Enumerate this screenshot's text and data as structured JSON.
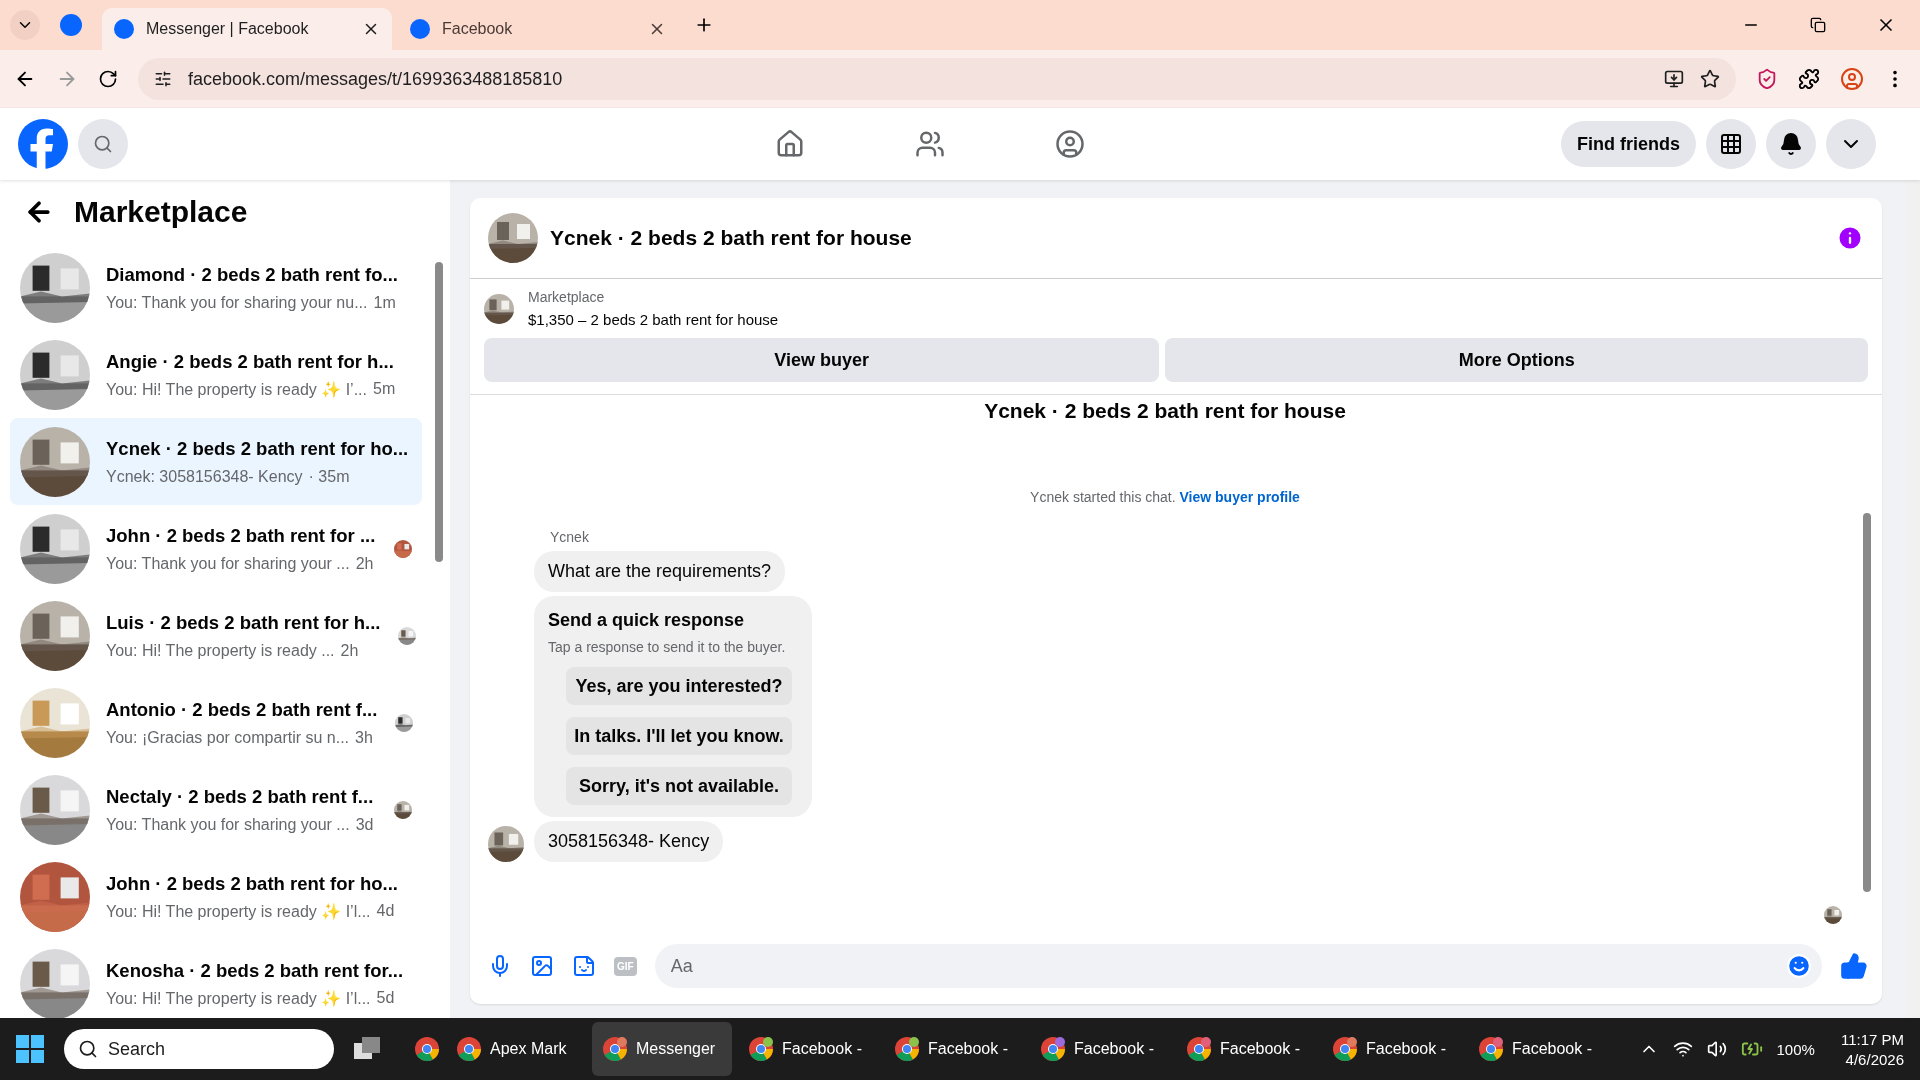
{
  "browser": {
    "tabs": [
      {
        "title": "Messenger | Facebook",
        "selected": true
      },
      {
        "title": "Facebook",
        "selected": false
      }
    ],
    "url": "facebook.com/messages/t/1699363488185810"
  },
  "header": {
    "find_friends": "Find friends"
  },
  "sidebar": {
    "title": "Marketplace",
    "conversations": [
      {
        "title": "Diamond · 2 beds 2 bath rent fo...",
        "preview": "You: Thank you for sharing your nu...",
        "time": "1m",
        "selected": false,
        "seen": false
      },
      {
        "title": "Angie · 2 beds 2 bath rent for h...",
        "preview": "You: Hi! The property is ready ✨ I’...",
        "time": "5m",
        "selected": false,
        "seen": false
      },
      {
        "title": "Ycnek · 2 beds 2 bath rent for ho...",
        "preview": "Ycnek: 3058156348- Kency",
        "time": "· 35m",
        "selected": true,
        "seen": false
      },
      {
        "title": "John · 2 beds 2 bath rent for ...",
        "preview": "You: Thank you for sharing your ...",
        "time": "2h",
        "selected": false,
        "seen": true
      },
      {
        "title": "Luis · 2 beds 2 bath rent for h...",
        "preview": "You: Hi! The property is ready ...",
        "time": "2h",
        "selected": false,
        "seen": true
      },
      {
        "title": "Antonio · 2 beds 2 bath rent f...",
        "preview": "You: ¡Gracias por compartir su n...",
        "time": "3h",
        "selected": false,
        "seen": true
      },
      {
        "title": "Nectaly · 2 beds 2 bath rent f...",
        "preview": "You: Thank you for sharing your ...",
        "time": "3d",
        "selected": false,
        "seen": true
      },
      {
        "title": "John · 2 beds 2 bath rent for ho...",
        "preview": "You: Hi! The property is ready ✨ I’l...",
        "time": "4d",
        "selected": false,
        "seen": false
      },
      {
        "title": "Kenosha · 2 beds 2 bath rent for...",
        "preview": "You: Hi! The property is ready ✨ I’l...",
        "time": "5d",
        "selected": false,
        "seen": false
      }
    ]
  },
  "chat": {
    "title": "Ycnek · 2 beds 2 bath rent for house",
    "listing": {
      "label": "Marketplace",
      "text": "$1,350 – 2 beds 2 bath rent for house"
    },
    "buttons": [
      "View buyer",
      "More Options"
    ],
    "thread_title": "Ycnek · 2 beds 2 bath rent for house",
    "note": {
      "text": "Ycnek started this chat.",
      "link": "View buyer profile"
    },
    "sender": "Ycnek",
    "messages": [
      {
        "kind": "text",
        "text": "What are the requirements?",
        "avatar": false
      },
      {
        "kind": "quick",
        "title": "Send a quick response",
        "hint": "Tap a response to send it to the buyer.",
        "options": [
          "Yes, are you interested?",
          "In talks. I'll let you know.",
          "Sorry, it's not available."
        ]
      },
      {
        "kind": "text",
        "text": "3058156348- Kency",
        "avatar": true
      }
    ],
    "gif_label": "GIF",
    "placeholder": "Aa"
  },
  "taskbar": {
    "search": "Search",
    "apps": [
      {
        "label": "Apex Mark",
        "active": false
      },
      {
        "label": "Messenger",
        "active": true
      },
      {
        "label": "Facebook -",
        "active": false
      },
      {
        "label": "Facebook -",
        "active": false
      },
      {
        "label": "Facebook -",
        "active": false
      },
      {
        "label": "Facebook -",
        "active": false
      },
      {
        "label": "Facebook -",
        "active": false
      },
      {
        "label": "Facebook -",
        "active": false
      }
    ],
    "battery": "100%",
    "time": "11:17 PM",
    "date": "4/6/2026"
  }
}
